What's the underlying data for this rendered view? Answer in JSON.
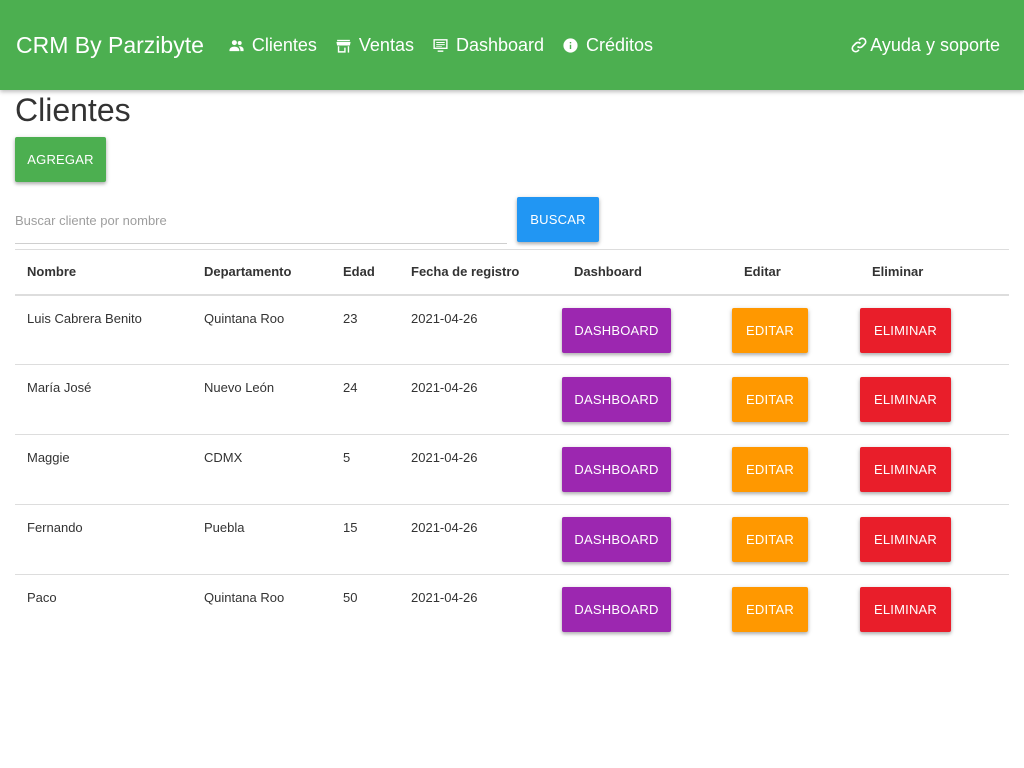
{
  "navbar": {
    "brand": "CRM By Parzibyte",
    "links": [
      {
        "label": "Clientes",
        "icon": "people-icon"
      },
      {
        "label": "Ventas",
        "icon": "store-icon"
      },
      {
        "label": "Dashboard",
        "icon": "monitor-icon"
      },
      {
        "label": "Créditos",
        "icon": "info-icon"
      }
    ],
    "help": {
      "label": "Ayuda y soporte",
      "icon": "link-icon"
    }
  },
  "page": {
    "title": "Clientes",
    "add_label": "Agregar"
  },
  "search": {
    "placeholder": "Buscar cliente por nombre",
    "value": "",
    "button_label": "Buscar"
  },
  "table": {
    "columns": [
      "Nombre",
      "Departamento",
      "Edad",
      "Fecha de registro",
      "Dashboard",
      "Editar",
      "Eliminar"
    ],
    "rows": [
      {
        "nombre": "Luis Cabrera Benito",
        "departamento": "Quintana Roo",
        "edad": "23",
        "fecha": "2021-04-26"
      },
      {
        "nombre": "María José",
        "departamento": "Nuevo León",
        "edad": "24",
        "fecha": "2021-04-26"
      },
      {
        "nombre": "Maggie",
        "departamento": "CDMX",
        "edad": "5",
        "fecha": "2021-04-26"
      },
      {
        "nombre": "Fernando",
        "departamento": "Puebla",
        "edad": "15",
        "fecha": "2021-04-26"
      },
      {
        "nombre": "Paco",
        "departamento": "Quintana Roo",
        "edad": "50",
        "fecha": "2021-04-26"
      }
    ],
    "row_actions": {
      "dashboard_label": "Dashboard",
      "edit_label": "Editar",
      "delete_label": "Eliminar"
    }
  },
  "colors": {
    "primary": "#4caf50",
    "search": "#2196f3",
    "dashboard": "#9c27b0",
    "edit": "#ff9800",
    "delete": "#e91e2a"
  }
}
